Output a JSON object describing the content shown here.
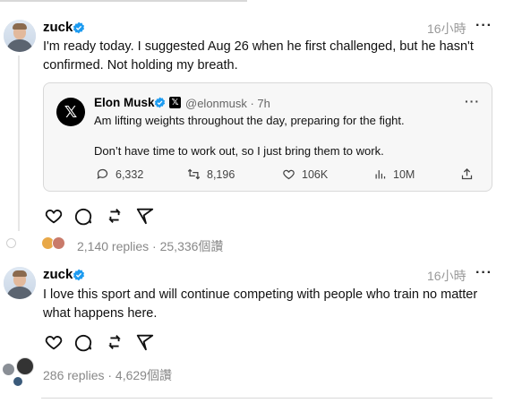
{
  "posts": [
    {
      "author": "zuck",
      "time": "16小時",
      "more": "···",
      "text_lines": [
        "I'm ready today. I suggested Aug 26 when he first challenged, but he hasn't",
        "confirmed. Not holding my breath."
      ],
      "replies_summary": "2,140 replies · 25,336個讚"
    },
    {
      "author": "zuck",
      "time": "16小時",
      "more": "···",
      "text_lines": [
        "I love this sport and will continue competing with people who train no matter",
        "what happens here."
      ],
      "replies_summary": "286 replies · 4,629個讚"
    }
  ],
  "quote": {
    "avatar_letter": "𝕏",
    "author": "Elon Musk",
    "badge": "𝕏",
    "handle_time": "@elonmusk · 7h",
    "more": "···",
    "line1": "Am lifting weights throughout the day, preparing for the fight.",
    "line2": "Don’t have time to work out, so I just bring them to work.",
    "stats": {
      "replies": "6,332",
      "reposts": "8,196",
      "likes": "106K",
      "views": "10M"
    }
  },
  "colors": {
    "verified": "#1d9bf0",
    "muted": "#999999"
  },
  "icons": [
    "verified-icon",
    "heart-icon",
    "comment-icon",
    "repost-icon",
    "share-icon",
    "reply-icon",
    "retweet-icon",
    "views-icon",
    "upload-icon",
    "more-icon"
  ]
}
